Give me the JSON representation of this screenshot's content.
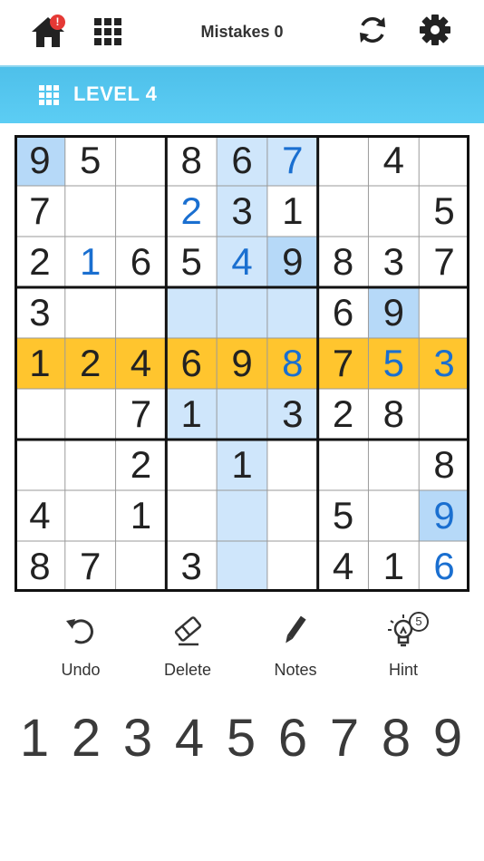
{
  "header": {
    "home_icon": "home-icon",
    "home_badge": "!",
    "grid_icon": "grid-icon",
    "mistakes_label": "Mistakes 0",
    "refresh_icon": "refresh-icon",
    "settings_icon": "gear-icon"
  },
  "level_bar": {
    "icon": "grid-icon",
    "label": "LEVEL 4"
  },
  "colors": {
    "level_bar": "#55c8f0",
    "selected_row": "#ffc52e",
    "related_highlight": "#cfe6fb",
    "selected_cell": "#b6d9f8",
    "user_digit": "#1a6fd0",
    "given_digit": "#222222"
  },
  "board": {
    "selected": [
      4,
      5
    ],
    "rows": [
      [
        "9",
        "5",
        "",
        "8",
        "6",
        "7",
        "",
        "4",
        ""
      ],
      [
        "7",
        "",
        "",
        "2",
        "3",
        "1",
        "",
        "",
        "5"
      ],
      [
        "2",
        "1",
        "6",
        "5",
        "4",
        "9",
        "8",
        "3",
        "7"
      ],
      [
        "3",
        "",
        "",
        "",
        "",
        "",
        "6",
        "9",
        ""
      ],
      [
        "1",
        "2",
        "4",
        "6",
        "9",
        "8",
        "7",
        "5",
        "3"
      ],
      [
        "",
        "",
        "7",
        "1",
        "",
        "3",
        "2",
        "8",
        ""
      ],
      [
        "",
        "",
        "2",
        "",
        "1",
        "",
        "",
        "",
        "8"
      ],
      [
        "4",
        "",
        "1",
        "",
        "",
        "",
        "5",
        "",
        "9"
      ],
      [
        "8",
        "7",
        "",
        "3",
        "",
        "",
        "4",
        "1",
        "6"
      ]
    ],
    "user_cells": [
      [
        0,
        5
      ],
      [
        1,
        3
      ],
      [
        2,
        1
      ],
      [
        2,
        4
      ],
      [
        4,
        5
      ],
      [
        4,
        7
      ],
      [
        4,
        8
      ],
      [
        7,
        8
      ],
      [
        8,
        8
      ]
    ],
    "highlight_cells": [
      [
        0,
        0
      ],
      [
        0,
        4
      ],
      [
        0,
        5
      ],
      [
        1,
        4
      ],
      [
        2,
        4
      ],
      [
        2,
        5
      ],
      [
        3,
        3
      ],
      [
        3,
        4
      ],
      [
        3,
        5
      ],
      [
        3,
        7
      ],
      [
        5,
        3
      ],
      [
        5,
        4
      ],
      [
        5,
        5
      ],
      [
        6,
        4
      ],
      [
        7,
        4
      ],
      [
        7,
        8
      ],
      [
        8,
        4
      ]
    ],
    "selected_match_cells": [
      [
        0,
        0
      ],
      [
        2,
        5
      ],
      [
        3,
        7
      ],
      [
        7,
        8
      ]
    ]
  },
  "tools": [
    {
      "name": "undo",
      "label": "Undo",
      "icon": "undo-icon"
    },
    {
      "name": "delete",
      "label": "Delete",
      "icon": "eraser-icon"
    },
    {
      "name": "notes",
      "label": "Notes",
      "icon": "pencil-icon"
    },
    {
      "name": "hint",
      "label": "Hint",
      "icon": "lightbulb-icon",
      "badge": "5"
    }
  ],
  "numpad": [
    "1",
    "2",
    "3",
    "4",
    "5",
    "6",
    "7",
    "8",
    "9"
  ]
}
